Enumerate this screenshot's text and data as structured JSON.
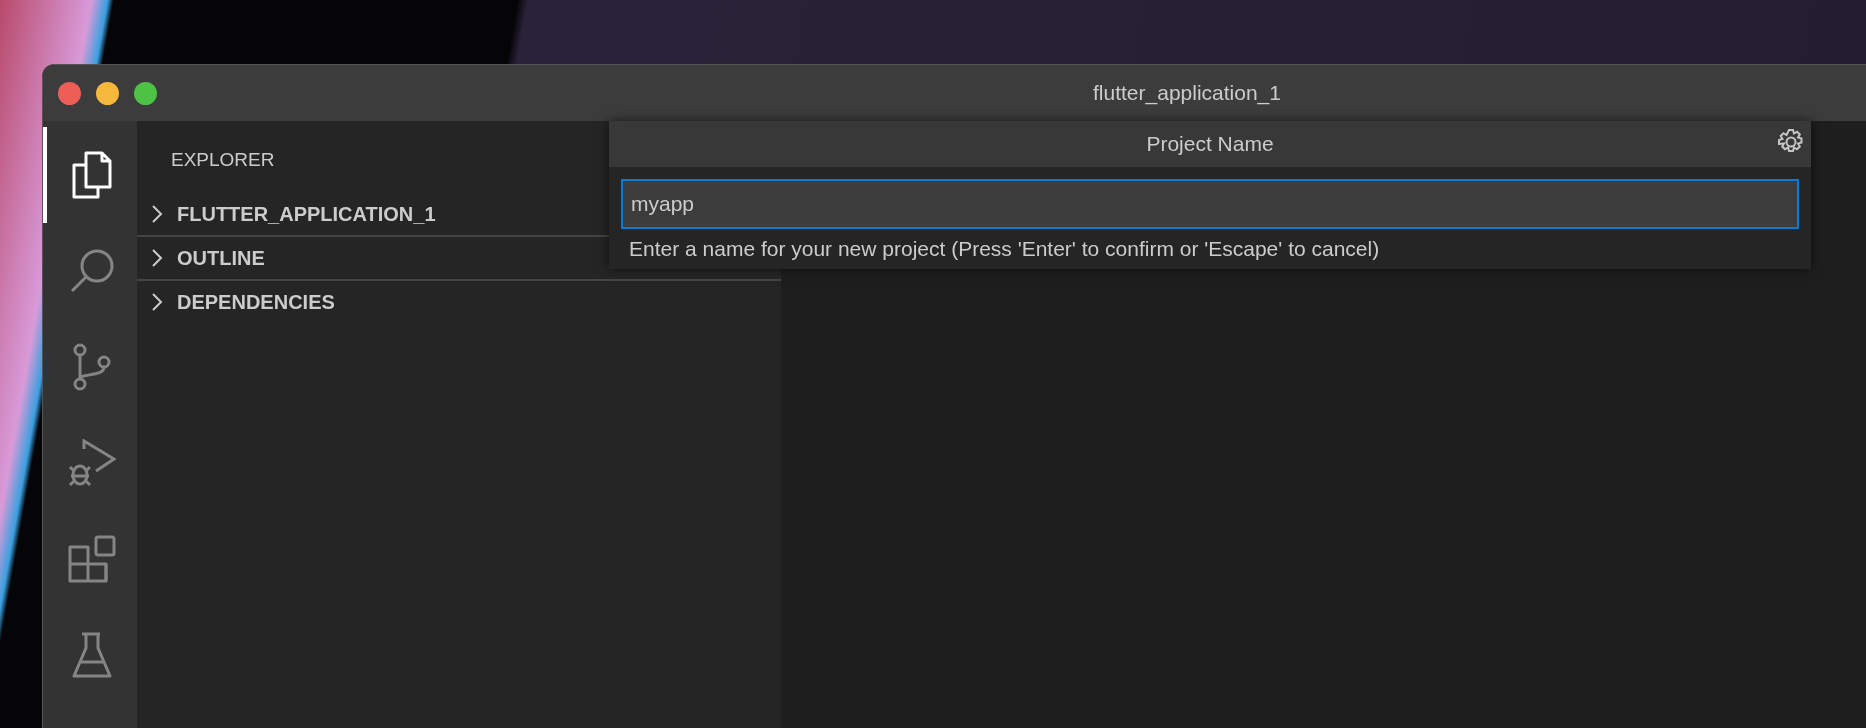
{
  "window": {
    "title": "flutter_application_1"
  },
  "activity_bar": [
    {
      "kind": "files",
      "selected": true
    },
    {
      "kind": "search",
      "selected": false
    },
    {
      "kind": "source-control",
      "selected": false
    },
    {
      "kind": "run-debug",
      "selected": false
    },
    {
      "kind": "extensions",
      "selected": false
    },
    {
      "kind": "testing",
      "selected": false
    }
  ],
  "sidebar": {
    "title": "EXPLORER",
    "sections": [
      {
        "label": "FLUTTER_APPLICATION_1",
        "expanded": false
      },
      {
        "label": "OUTLINE",
        "expanded": false
      },
      {
        "label": "DEPENDENCIES",
        "expanded": false
      }
    ]
  },
  "quick_input": {
    "title": "Project Name",
    "value": "myapp",
    "message": "Enter a name for your new project (Press 'Enter' to confirm or 'Escape' to cancel)"
  }
}
